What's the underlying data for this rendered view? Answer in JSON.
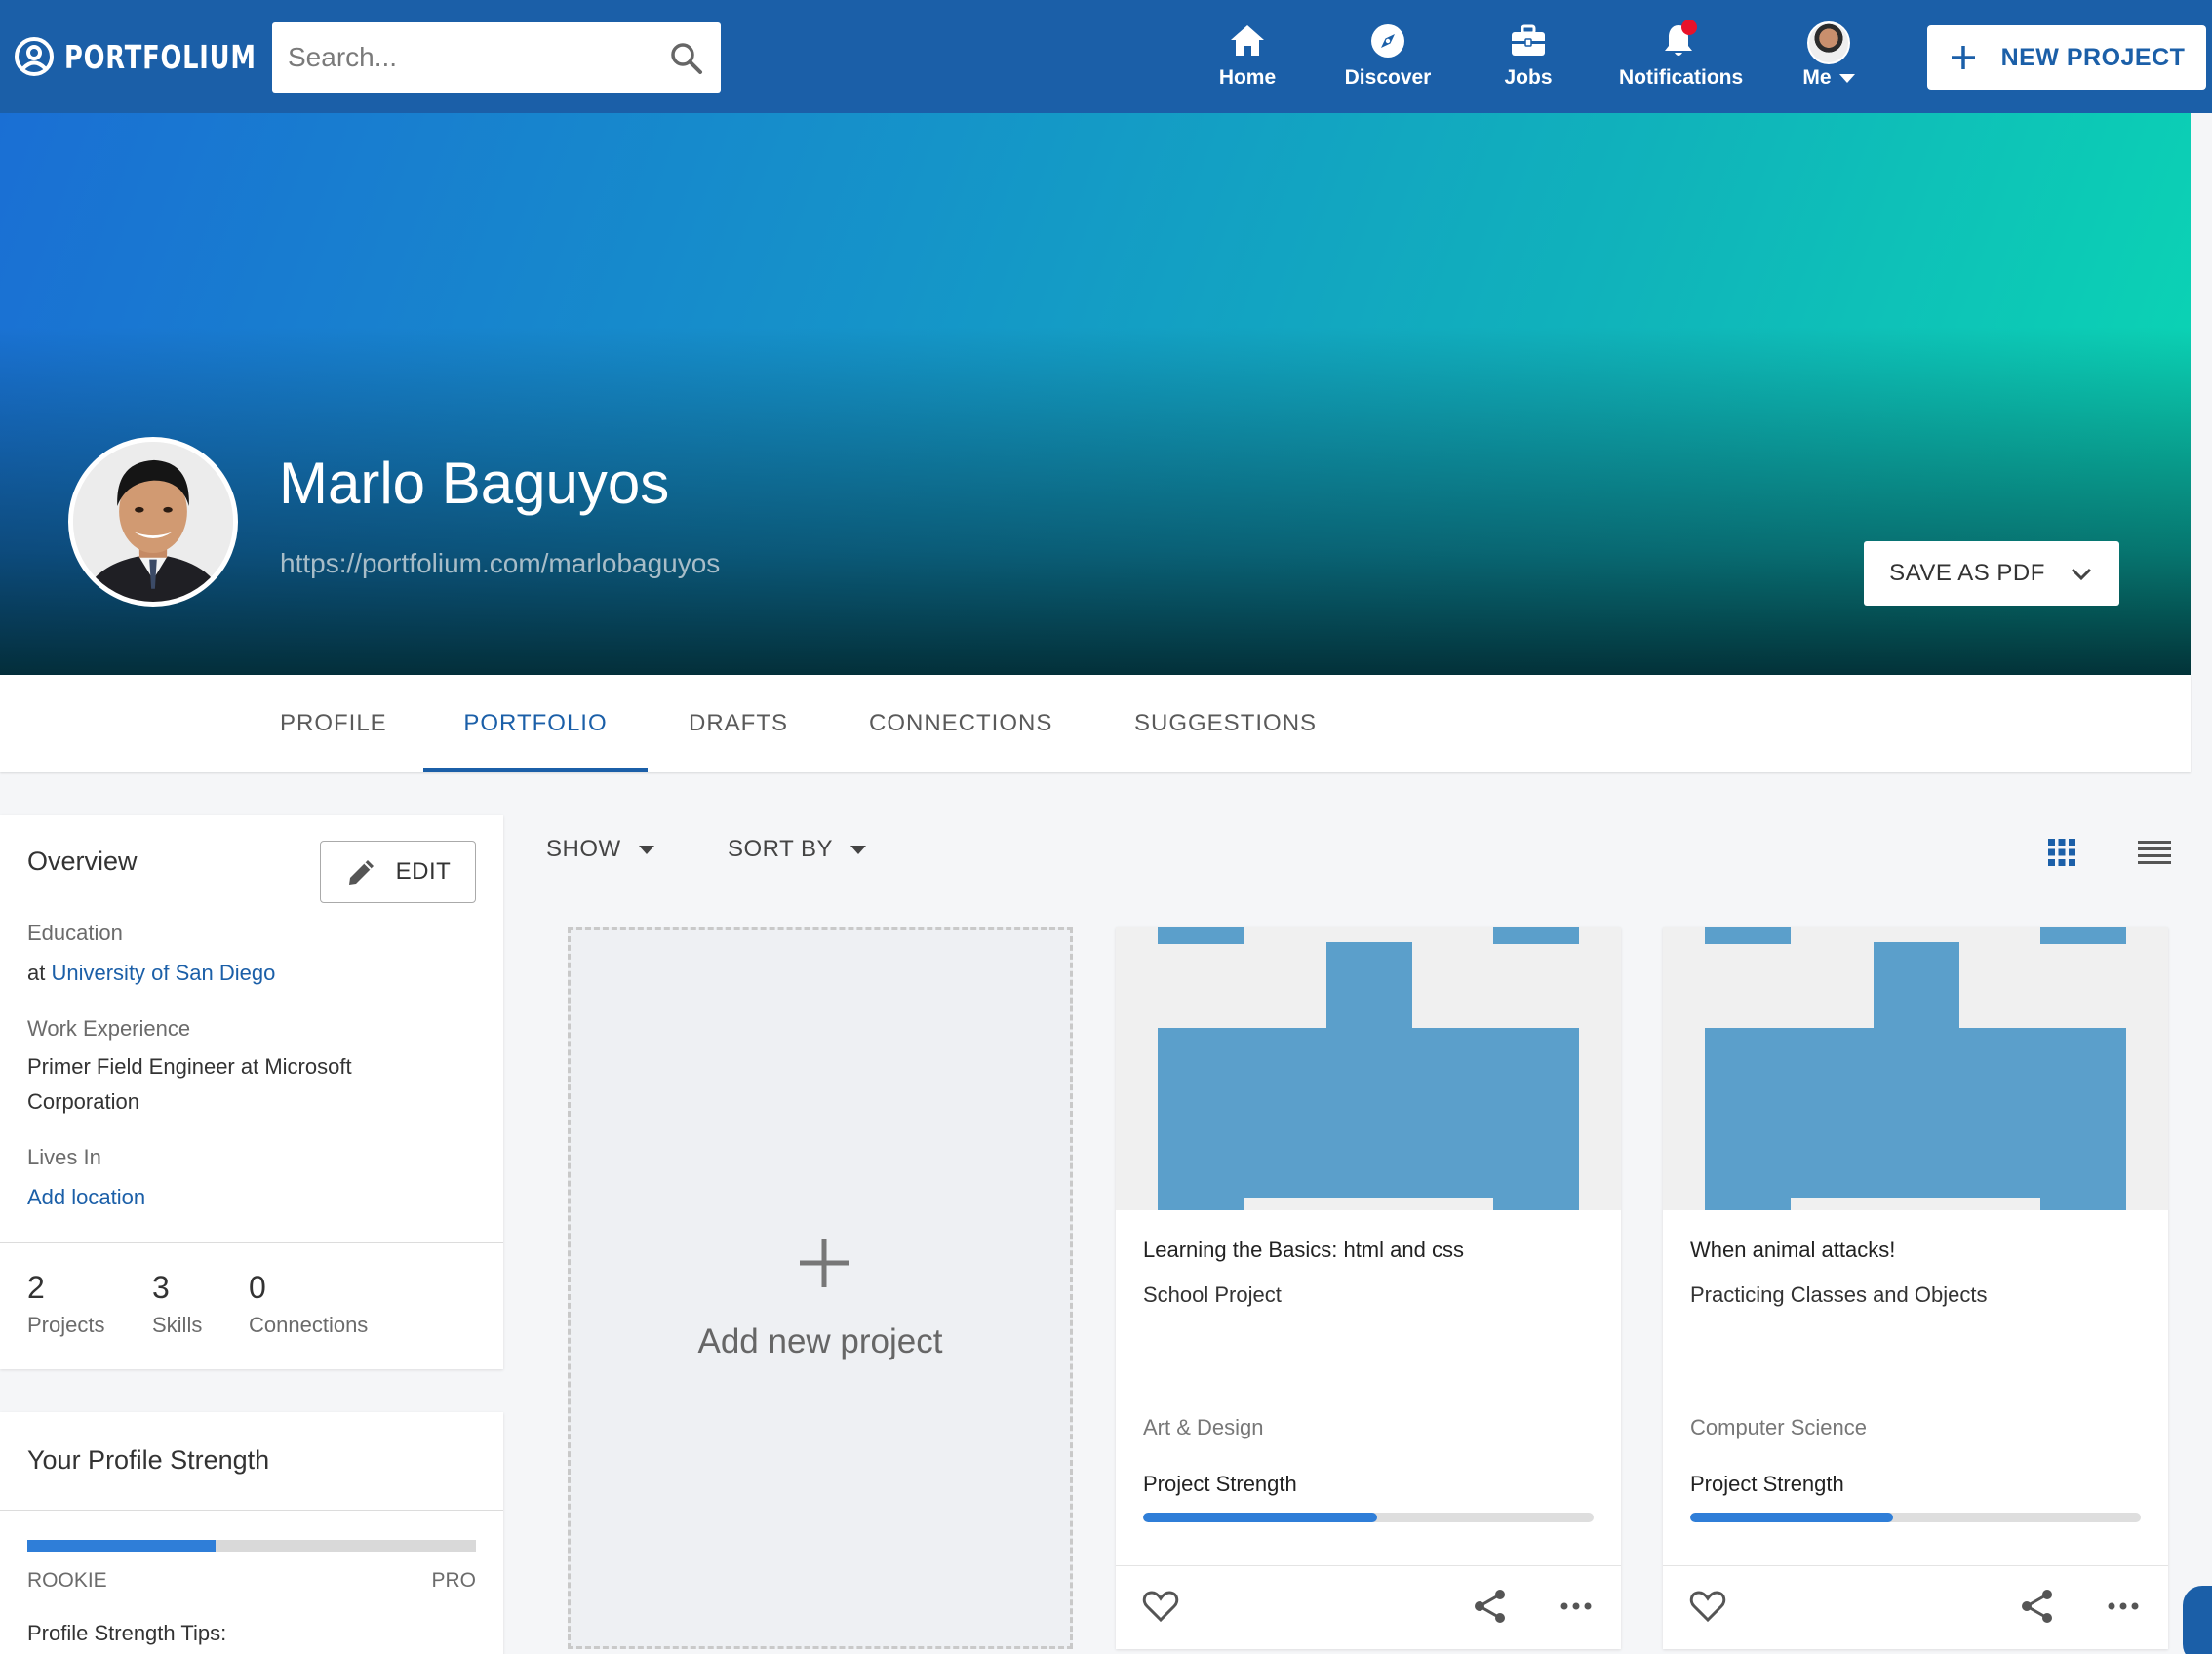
{
  "app": {
    "logo_text": "PORTFOLIUM"
  },
  "search": {
    "placeholder": "Search..."
  },
  "nav": {
    "home": "Home",
    "discover": "Discover",
    "jobs": "Jobs",
    "notifications": "Notifications",
    "me": "Me",
    "new_project": "NEW PROJECT"
  },
  "profile": {
    "name": "Marlo Baguyos",
    "url": "https://portfolium.com/marlobaguyos",
    "save_pdf": "SAVE AS PDF"
  },
  "tabs": [
    "PROFILE",
    "PORTFOLIO",
    "DRAFTS",
    "CONNECTIONS",
    "SUGGESTIONS"
  ],
  "active_tab": "PORTFOLIO",
  "overview": {
    "title": "Overview",
    "edit": "EDIT",
    "education_label": "Education",
    "education_prefix": "at",
    "education_school": "University of San Diego",
    "work_label": "Work Experience",
    "work_line1": "Primer Field Engineer at Microsoft",
    "work_line2": "Corporation",
    "lives_label": "Lives In",
    "lives_link": "Add location",
    "stats": [
      {
        "value": "2",
        "label": "Projects"
      },
      {
        "value": "3",
        "label": "Skills"
      },
      {
        "value": "0",
        "label": "Connections"
      }
    ]
  },
  "profile_strength": {
    "title": "Your Profile Strength",
    "value_fraction": 0.42,
    "min_label": "ROOKIE",
    "max_label": "PRO",
    "tips_label": "Profile Strength Tips:"
  },
  "toolbar": {
    "show": "SHOW",
    "sort_by": "SORT BY"
  },
  "add_project": {
    "label": "Add new project"
  },
  "projects": [
    {
      "title": "Learning the Basics: html and css",
      "subtitle": "School Project",
      "category": "Art & Design",
      "strength_label": "Project Strength",
      "strength_fraction": 0.52
    },
    {
      "title": "When animal attacks!",
      "subtitle": "Practicing Classes and Objects",
      "category": "Computer Science",
      "strength_label": "Project Strength",
      "strength_fraction": 0.45
    }
  ],
  "colors": {
    "brand": "#1b5fa8",
    "accent_bar": "#2f7ed8",
    "thumb_blue": "#5b9fcb",
    "notification_dot": "#e8122a"
  }
}
